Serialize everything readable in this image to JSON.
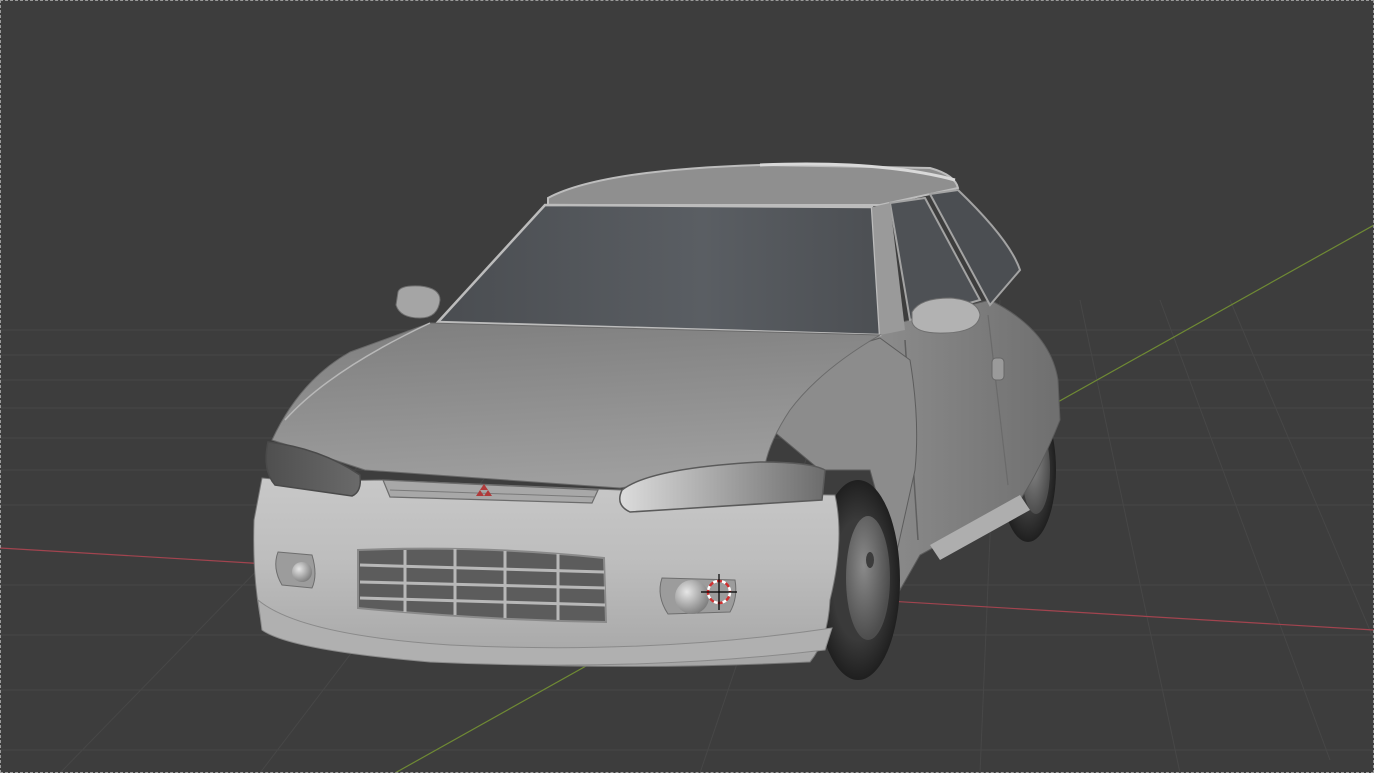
{
  "viewport": {
    "background_color": "#3d3d3d",
    "grid_line_color": "#4a4a4a",
    "x_axis_color": "#a2444f",
    "y_axis_color": "#6f8a34",
    "object": "car-model",
    "shading": "solid",
    "grille_emblem_color": "#b03a3a",
    "cursor_icon": "3d-cursor-icon"
  }
}
